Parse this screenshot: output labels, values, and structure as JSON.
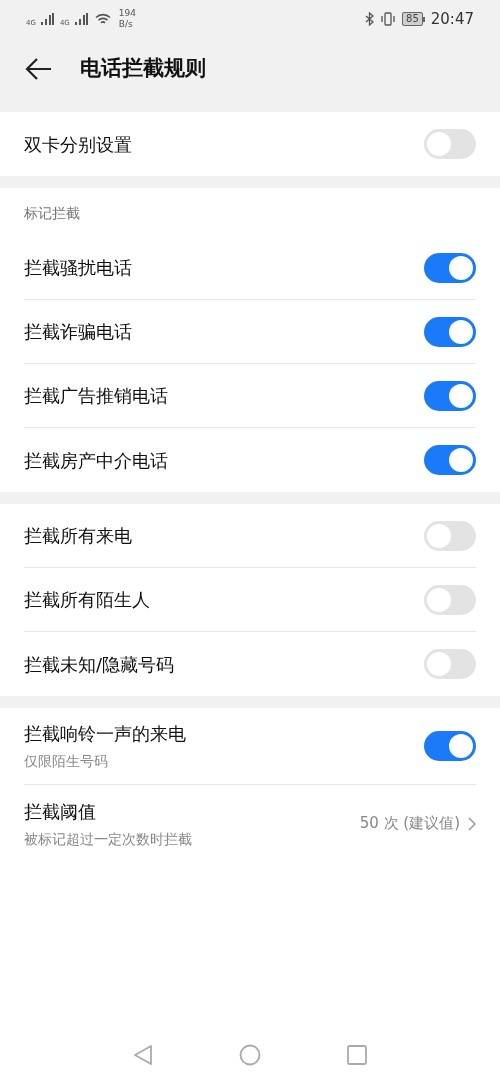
{
  "status_bar": {
    "network_1": "4G",
    "network_2": "4G",
    "speed_value": "194",
    "speed_unit": "B/s",
    "battery": "85",
    "time": "20:47"
  },
  "header": {
    "title": "电话拦截规则"
  },
  "sections": [
    {
      "items": [
        {
          "kind": "toggle",
          "label": "双卡分别设置",
          "on": false
        }
      ]
    },
    {
      "title": "标记拦截",
      "items": [
        {
          "kind": "toggle",
          "label": "拦截骚扰电话",
          "on": true
        },
        {
          "kind": "toggle",
          "label": "拦截诈骗电话",
          "on": true
        },
        {
          "kind": "toggle",
          "label": "拦截广告推销电话",
          "on": true
        },
        {
          "kind": "toggle",
          "label": "拦截房产中介电话",
          "on": true
        }
      ]
    },
    {
      "items": [
        {
          "kind": "toggle",
          "label": "拦截所有来电",
          "on": false
        },
        {
          "kind": "toggle",
          "label": "拦截所有陌生人",
          "on": false
        },
        {
          "kind": "toggle",
          "label": "拦截未知/隐藏号码",
          "on": false
        }
      ]
    },
    {
      "items": [
        {
          "kind": "toggle",
          "label": "拦截响铃一声的来电",
          "subtitle": "仅限陌生号码",
          "on": true
        },
        {
          "kind": "value",
          "label": "拦截阈值",
          "subtitle": "被标记超过一定次数时拦截",
          "value": "50 次 (建议值)"
        }
      ]
    }
  ]
}
